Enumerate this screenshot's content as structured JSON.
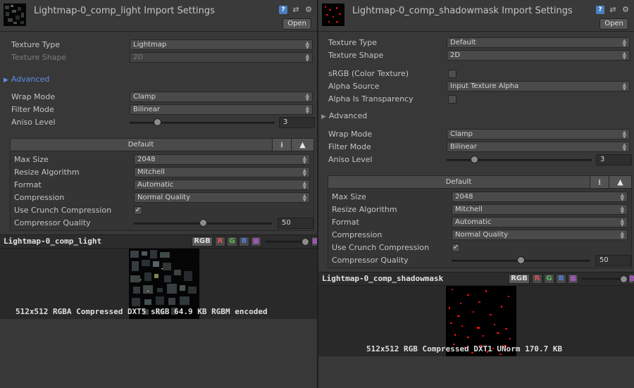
{
  "colors": {
    "panel_bg": "#383838",
    "accent_blue": "#5d8ee6",
    "red_channel": "#e05050",
    "green_channel": "#50c050",
    "blue_channel": "#5080e0"
  },
  "left": {
    "title": "Lightmap-0_comp_light Import Settings",
    "open_button": "Open",
    "texture_type_label": "Texture Type",
    "texture_type_value": "Lightmap",
    "texture_shape_label": "Texture Shape",
    "texture_shape_value": "2D",
    "advanced_label": "Advanced",
    "wrap_mode_label": "Wrap Mode",
    "wrap_mode_value": "Clamp",
    "filter_mode_label": "Filter Mode",
    "filter_mode_value": "Bilinear",
    "aniso_label": "Aniso Level",
    "aniso_value": "3",
    "aniso_fraction": 0.19,
    "platform_tab": "Default",
    "max_size_label": "Max Size",
    "max_size_value": "2048",
    "resize_label": "Resize Algorithm",
    "resize_value": "Mitchell",
    "format_label": "Format",
    "format_value": "Automatic",
    "compression_label": "Compression",
    "compression_value": "Normal Quality",
    "crunch_label": "Use Crunch Compression",
    "crunch_checked": true,
    "quality_label": "Compressor Quality",
    "quality_value": "50",
    "quality_fraction": 0.5,
    "preview_name": "Lightmap-0_comp_light",
    "channels": {
      "rgb": "RGB",
      "r": "R",
      "g": "G",
      "b": "B"
    },
    "info_text": "512x512  RGBA Compressed DXT5 sRGB   64.9 KB   RGBM encoded"
  },
  "right": {
    "title": "Lightmap-0_comp_shadowmask Import Settings",
    "open_button": "Open",
    "texture_type_label": "Texture Type",
    "texture_type_value": "Default",
    "texture_shape_label": "Texture Shape",
    "texture_shape_value": "2D",
    "srgb_label": "sRGB (Color Texture)",
    "srgb_checked": false,
    "alpha_source_label": "Alpha Source",
    "alpha_source_value": "Input Texture Alpha",
    "alpha_transparency_label": "Alpha Is Transparency",
    "alpha_transparency_checked": false,
    "advanced_label": "Advanced",
    "wrap_mode_label": "Wrap Mode",
    "wrap_mode_value": "Clamp",
    "filter_mode_label": "Filter Mode",
    "filter_mode_value": "Bilinear",
    "aniso_label": "Aniso Level",
    "aniso_value": "3",
    "aniso_fraction": 0.19,
    "platform_tab": "Default",
    "max_size_label": "Max Size",
    "max_size_value": "2048",
    "resize_label": "Resize Algorithm",
    "resize_value": "Mitchell",
    "format_label": "Format",
    "format_value": "Automatic",
    "compression_label": "Compression",
    "compression_value": "Normal Quality",
    "crunch_label": "Use Crunch Compression",
    "crunch_checked": true,
    "quality_label": "Compressor Quality",
    "quality_value": "50",
    "quality_fraction": 0.5,
    "preview_name": "Lightmap-0_comp_shadowmask",
    "channels": {
      "rgb": "RGB",
      "r": "R",
      "g": "G",
      "b": "B"
    },
    "info_text": "512x512  RGB Compressed DXT1 UNorm   170.7 KB"
  }
}
